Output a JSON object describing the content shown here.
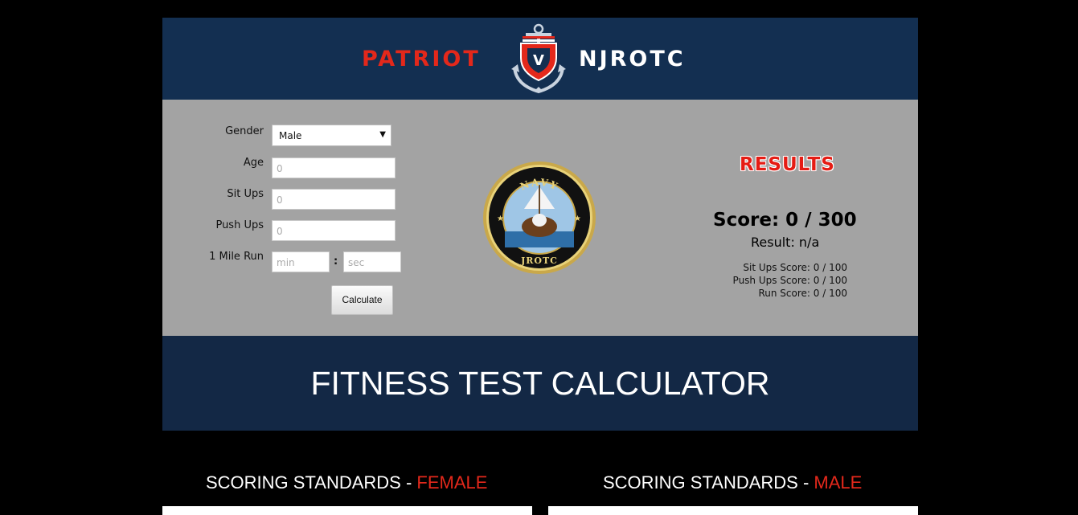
{
  "header": {
    "brand_left": "PATRIOT",
    "brand_right": "NJROTC",
    "colors": {
      "navy": "#132f51",
      "red": "#e3281b"
    }
  },
  "form": {
    "gender_label": "Gender",
    "gender_value": "Male",
    "age_label": "Age",
    "age_placeholder": "0",
    "situps_label": "Sit Ups",
    "situps_placeholder": "0",
    "pushups_label": "Push Ups",
    "pushups_placeholder": "0",
    "run_label": "1 Mile Run",
    "run_min_placeholder": "min",
    "run_sec_placeholder": "sec",
    "colon": ":",
    "calculate_label": "Calculate"
  },
  "seal": {
    "top_text": "NAVY",
    "bottom_text": "JROTC"
  },
  "results": {
    "title": "RESULTS",
    "score": "Score: 0 / 300",
    "result": "Result: n/a",
    "situps_score": "Sit Ups Score: 0 / 100",
    "pushups_score": "Push Ups Score: 0 / 100",
    "run_score": "Run Score: 0 / 100"
  },
  "banner": {
    "title": "FITNESS TEST CALCULATOR"
  },
  "standards": {
    "prefix": "SCORING STANDARDS - ",
    "female": "FEMALE",
    "male": "MALE"
  }
}
